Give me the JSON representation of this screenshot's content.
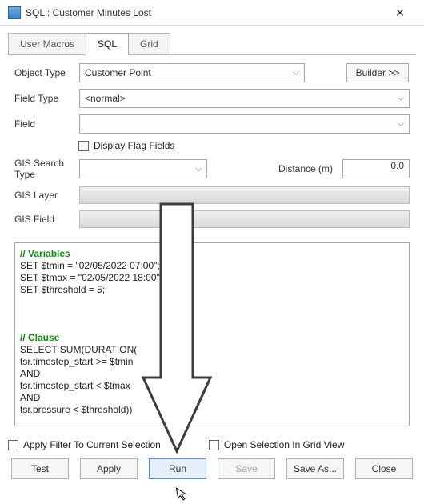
{
  "window": {
    "title": "SQL : Customer Minutes Lost"
  },
  "tabs": {
    "user_macros": "User Macros",
    "sql": "SQL",
    "grid": "Grid"
  },
  "form": {
    "object_type_label": "Object Type",
    "object_type_value": "Customer Point",
    "builder_label": "Builder >>",
    "field_type_label": "Field Type",
    "field_type_value": "<normal>",
    "field_label": "Field",
    "display_flag_label": "Display Flag Fields",
    "gis_search_type_label": "GIS Search\nType",
    "distance_label": "Distance (m)",
    "distance_value": "0.0",
    "gis_layer_label": "GIS Layer",
    "gis_field_label": "GIS Field"
  },
  "sql": {
    "comment_vars": "// Variables",
    "line1": "SET $tmin = \"02/05/2022 07:00\";",
    "line2": "SET $tmax = \"02/05/2022 18:00\";",
    "line3": "SET $threshold = 5;",
    "comment_clause": "// Clause",
    "line4": "SELECT SUM(DURATION(",
    "line5": "tsr.timestep_start >= $tmin",
    "line6": "AND",
    "line7": "tsr.timestep_start < $tmax",
    "line8": "AND",
    "line9": "tsr.pressure < $threshold))"
  },
  "bottom": {
    "apply_filter_label": "Apply Filter To Current Selection",
    "open_grid_label": "Open Selection In Grid View"
  },
  "buttons": {
    "test": "Test",
    "apply": "Apply",
    "run": "Run",
    "save": "Save",
    "save_as": "Save As...",
    "close": "Close"
  }
}
